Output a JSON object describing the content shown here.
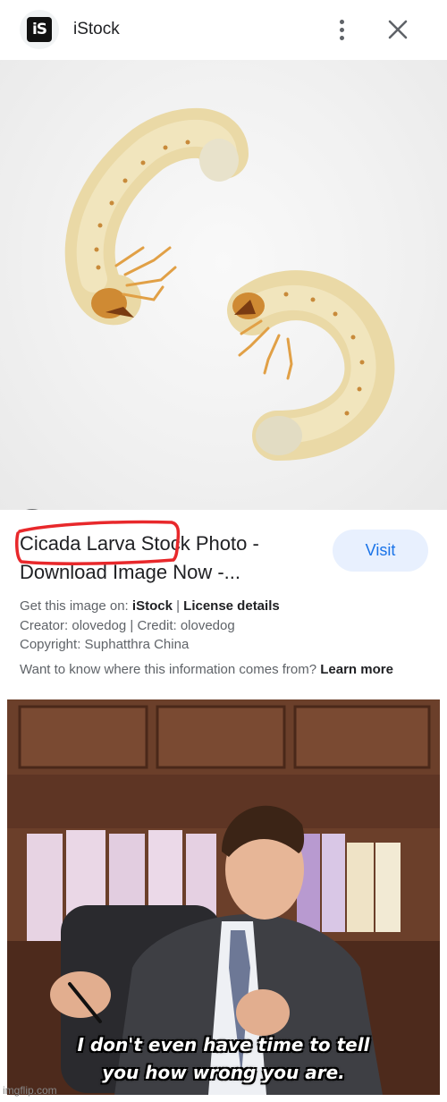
{
  "header": {
    "logo_text": "iS",
    "site_name": "iStock"
  },
  "icons": {
    "more": "more-vert-icon",
    "close": "close-icon",
    "lens": "google-lens-icon"
  },
  "result": {
    "title_line1": "Cicada Larva Stock Photo -",
    "title_line2": "Download Image Now -...",
    "visit_label": "Visit",
    "get_image_label": "Get this image on: ",
    "source_name": "iStock",
    "separator": " | ",
    "license_label": "License details",
    "creator": "Creator: olovedog | Credit: olovedog",
    "copyright": "Copyright: Suphatthra China",
    "info_question": "Want to know where this information comes from? ",
    "learn_more": "Learn more"
  },
  "meme": {
    "caption_line1": "I don't even have time to tell",
    "caption_line2": "you how wrong you are."
  },
  "watermark": "imgflip.com",
  "colors": {
    "accent_blue": "#1a73e8",
    "visit_bg": "#e8f0fe",
    "highlight_red": "#e8282b"
  }
}
